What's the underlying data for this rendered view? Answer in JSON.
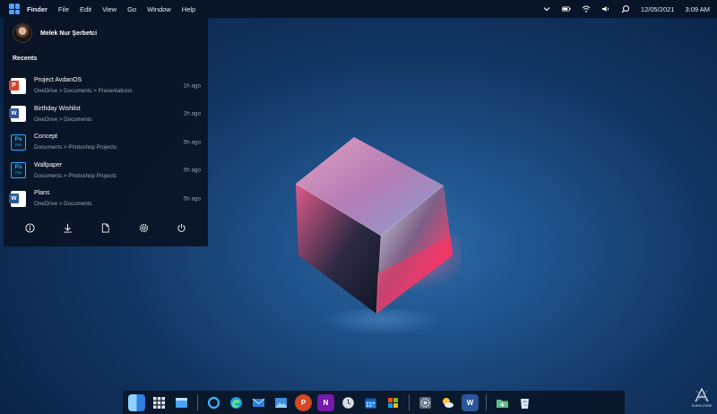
{
  "menubar": {
    "items": [
      "Finder",
      "File",
      "Edit",
      "View",
      "Go",
      "Window",
      "Help"
    ],
    "date": "12/05/2021",
    "time": "3:09 AM",
    "status_icons": [
      "chevron-down-icon",
      "battery-icon",
      "wifi-icon",
      "volume-icon",
      "search-icon"
    ]
  },
  "panel": {
    "user_name": "Melek Nur Şerbetci",
    "recents_title": "Recents",
    "recents": [
      {
        "name": "Project AvdanOS",
        "path": "OneDrive > Documents > Presentations",
        "time": "1h ago",
        "icon": "powerpoint-icon"
      },
      {
        "name": "Birthday Wishlist",
        "path": "OneDrive > Documents",
        "time": "2h ago",
        "icon": "word-icon"
      },
      {
        "name": "Concept",
        "path": "Documents > Photoshop Projects",
        "time": "5h ago",
        "icon": "photoshop-icon"
      },
      {
        "name": "Wallpaper",
        "path": "Documents > Photoshop Projects",
        "time": "5h ago",
        "icon": "photoshop-icon"
      },
      {
        "name": "Plans",
        "path": "OneDrive > Documents",
        "time": "5h ago",
        "icon": "word-icon"
      }
    ],
    "ps_label": "Ps",
    "ps_sub": "PSD",
    "actions": [
      "info-icon",
      "download-icon",
      "document-icon",
      "settings-icon",
      "power-icon"
    ]
  },
  "dock": {
    "apps": [
      "finder-icon",
      "app-grid-icon",
      "window-icon",
      "cortana-icon",
      "edge-icon",
      "mail-icon",
      "photos-icon",
      "powerpoint-icon",
      "onenote-icon",
      "clock-icon",
      "calendar-icon",
      "store-icon",
      "settings-icon",
      "weather-icon",
      "word-icon",
      "downloads-icon",
      "recycle-bin-icon"
    ],
    "labels": {
      "powerpoint": "P",
      "onenote": "N",
      "word": "W"
    }
  },
  "watermark": {
    "text": "SUBSCRIBE"
  },
  "colors": {
    "accent": "#4aa3ff",
    "panel_bg": "#0a1426",
    "muted_text": "#9aa6b6"
  }
}
